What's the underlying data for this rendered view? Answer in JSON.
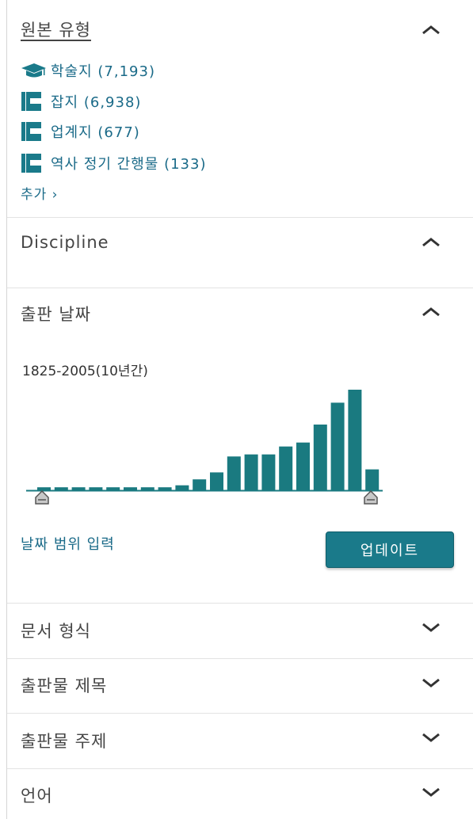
{
  "colors": {
    "accent": "#1a7a8a",
    "link": "#1a6a88",
    "bar": "#1a7a80",
    "divider": "#e3e3e3"
  },
  "source_type": {
    "title": "원본 유형",
    "toggle_icon": "chevron-up-icon",
    "items": [
      {
        "icon": "graduation-cap-icon",
        "label": "학술지 (7,193)"
      },
      {
        "icon": "magazine-icon",
        "label": "잡지 (6,938)"
      },
      {
        "icon": "magazine-icon",
        "label": "업계지 (677)"
      },
      {
        "icon": "magazine-icon",
        "label": "역사 정기 간행물 (133)"
      }
    ],
    "more_label": "추가 ›"
  },
  "discipline": {
    "title": "Discipline",
    "toggle_icon": "chevron-up-icon"
  },
  "pub_date": {
    "title": "출판 날짜",
    "toggle_icon": "chevron-up-icon",
    "range_label": "1825-2005(10년간)",
    "enter_range_label": "날짜 범위 입력",
    "update_label": "업데이트"
  },
  "chart_data": {
    "type": "bar",
    "range_start": 1825,
    "range_end": 2005,
    "bucket_years": 10,
    "values": [
      0.3,
      0.3,
      0.3,
      0.3,
      0.3,
      0.3,
      0.3,
      0.3,
      0.5,
      1.1,
      1.8,
      3.4,
      3.6,
      3.6,
      4.4,
      4.8,
      6.6,
      8.8,
      10.1,
      2.1
    ],
    "ylim": [
      0,
      10.5
    ],
    "grid": false,
    "slider_handles": [
      "left",
      "right"
    ]
  },
  "doc_format": {
    "title": "문서 형식",
    "toggle_icon": "chevron-down-icon"
  },
  "pub_title": {
    "title": "출판물 제목",
    "toggle_icon": "chevron-down-icon"
  },
  "pub_subject": {
    "title": "출판물 주제",
    "toggle_icon": "chevron-down-icon"
  },
  "language": {
    "title": "언어",
    "toggle_icon": "chevron-down-icon"
  }
}
